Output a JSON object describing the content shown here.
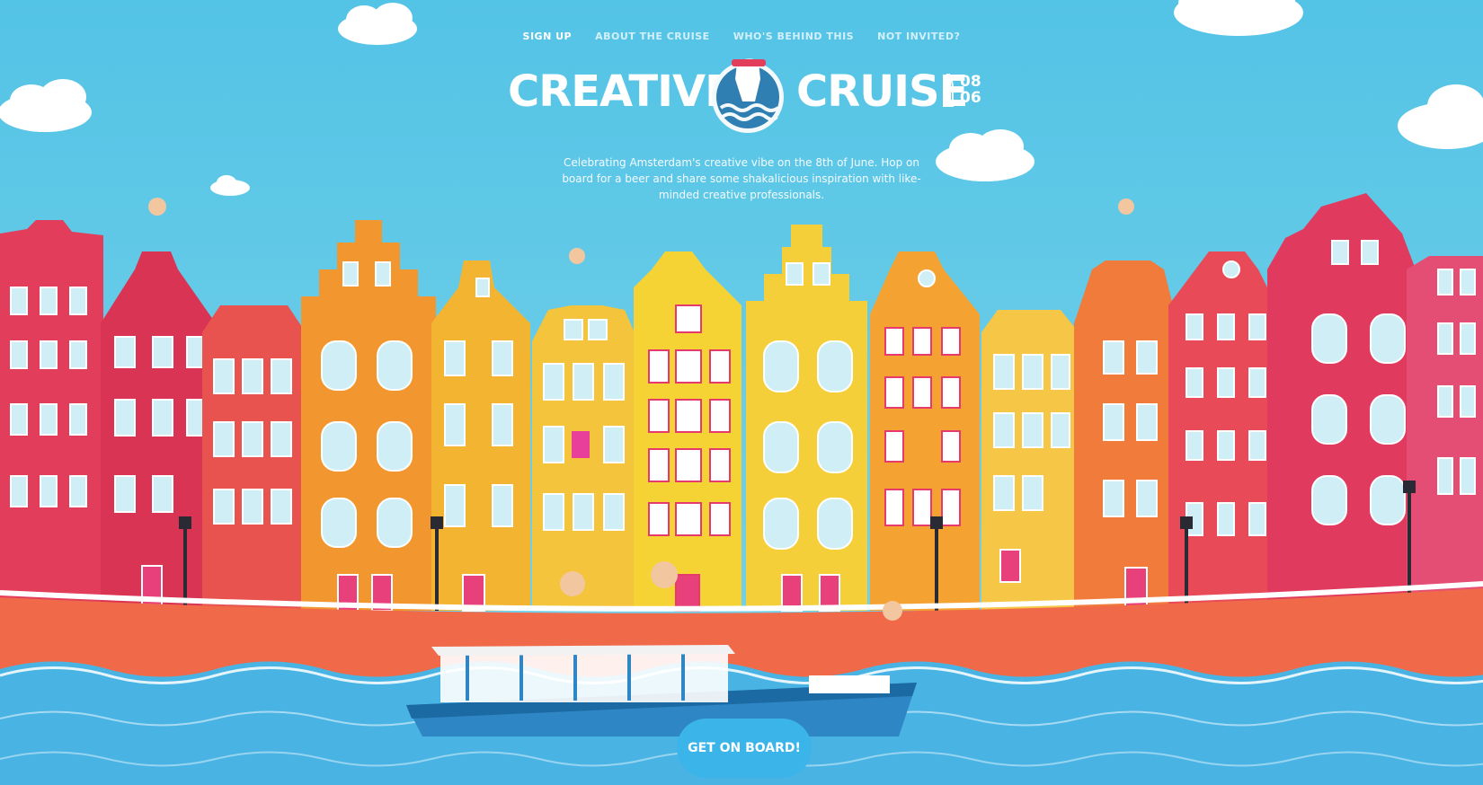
{
  "nav": {
    "items": [
      {
        "label": "SIGN UP"
      },
      {
        "label": "ABOUT THE CRUISE"
      },
      {
        "label": "WHO'S BEHIND THIS"
      },
      {
        "label": "NOT INVITED?"
      }
    ]
  },
  "logo": {
    "word1": "CREATIVE",
    "word2": "CRUISE",
    "date_line1": "08",
    "date_line2": "06"
  },
  "hero": {
    "tagline": "Celebrating Amsterdam's creative vibe on the 8th of June. Hop on board for a beer and share some shakalicious inspiration with like-minded creative professionals."
  },
  "cta": {
    "label": "GET ON BOARD!"
  },
  "colors": {
    "sky": "#5fc8e8",
    "water": "#49b4e4",
    "accent_red": "#e63c5a",
    "accent_orange": "#f29a2e",
    "accent_yellow": "#f6d13a",
    "boat": "#2f86c4"
  }
}
